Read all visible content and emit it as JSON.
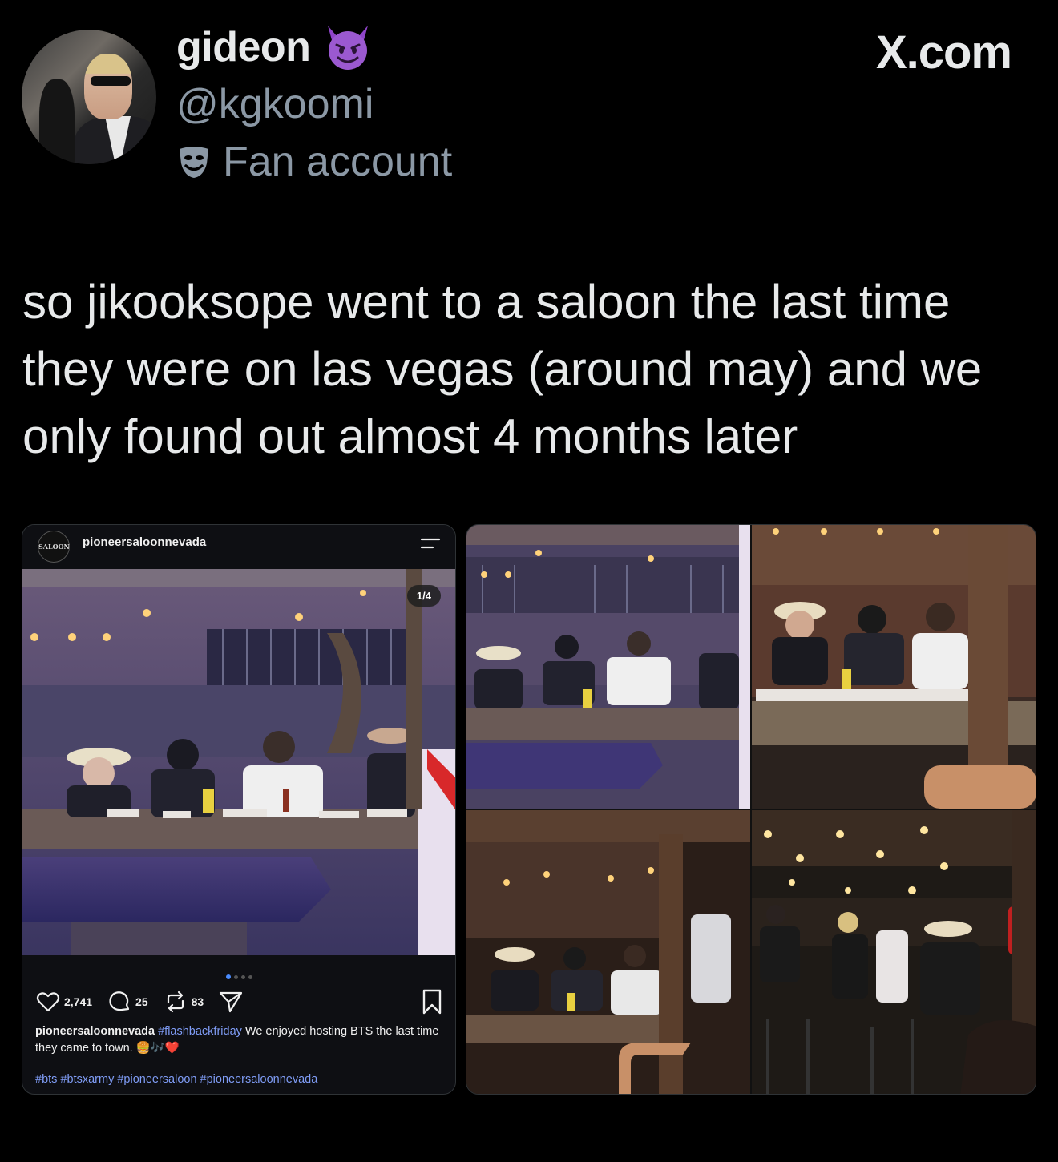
{
  "tweet": {
    "author": {
      "display_name": "gideon",
      "handle": "@kgkoomi",
      "affiliation": "Fan account",
      "name_emoji": "smiling-devil-emoji",
      "affiliation_icon": "theater-mask-icon"
    },
    "brand": "X.com",
    "text": "so jikooksope went to a saloon the last time they were on las vegas (around may) and we only found out almost 4 months later"
  },
  "instagram_post": {
    "username": "pioneersaloonnevada",
    "logo_text": "SALOON",
    "image_counter": "1/4",
    "carousel": {
      "count": 4,
      "active": 0
    },
    "likes": "2,741",
    "comments": "25",
    "reposts": "83",
    "caption_user": "pioneersaloonnevada",
    "caption_tag": "#flashbackfriday",
    "caption_text": " We enjoyed hosting BTS the last time they came to town. 🍔🎶❤️",
    "hashtags": "#bts #btsxarmy #pioneersaloon #pioneersaloonnevada"
  },
  "colors": {
    "background": "#000000",
    "text_primary": "#e7e9ea",
    "text_secondary": "#8b98a5",
    "hashtag": "#7f9cf5",
    "carousel_active": "#4a8cff"
  }
}
